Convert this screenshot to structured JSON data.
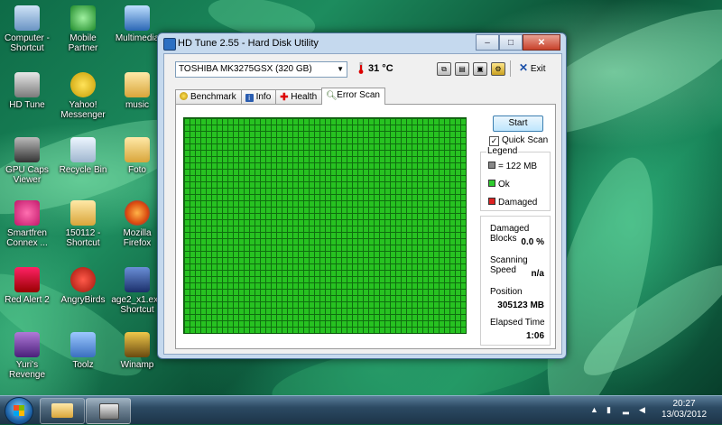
{
  "desktop": {
    "icons": [
      {
        "label": "Computer - Shortcut"
      },
      {
        "label": "Mobile Partner"
      },
      {
        "label": "Multimedia"
      },
      {
        "label": "HD Tune"
      },
      {
        "label": "Yahoo! Messenger"
      },
      {
        "label": "music"
      },
      {
        "label": "GPU Caps Viewer"
      },
      {
        "label": "Recycle Bin"
      },
      {
        "label": "Foto"
      },
      {
        "label": "Smartfren Connex ..."
      },
      {
        "label": "150112 - Shortcut"
      },
      {
        "label": "Mozilla Firefox"
      },
      {
        "label": "Red Alert 2"
      },
      {
        "label": "AngryBirds"
      },
      {
        "label": "age2_x1.exe Shortcut"
      },
      {
        "label": "Yuri's Revenge"
      },
      {
        "label": "Toolz"
      },
      {
        "label": "Winamp"
      }
    ]
  },
  "window": {
    "title": "HD Tune 2.55 - Hard Disk Utility",
    "controls": {
      "minimize": "–",
      "maximize": "□",
      "close": "✕"
    },
    "toolbar": {
      "drive": "TOSHIBA MK3275GSX (320 GB)",
      "temperature": "31 °C",
      "exit_label": "Exit"
    },
    "tabs": [
      {
        "label": "Benchmark"
      },
      {
        "label": "Info"
      },
      {
        "label": "Health"
      },
      {
        "label": "Error Scan"
      }
    ],
    "error_scan": {
      "start_label": "Start",
      "quick_scan_label": "Quick Scan",
      "quick_scan_checked": true,
      "legend_title": "Legend",
      "legend": [
        {
          "label": "= 122 MB",
          "color": "#888888"
        },
        {
          "label": "Ok",
          "color": "#2ecc2e"
        },
        {
          "label": "Damaged",
          "color": "#dd2222"
        }
      ],
      "stats": {
        "damaged_blocks_label": "Damaged Blocks",
        "damaged_blocks_value": "0.0 %",
        "scanning_speed_label": "Scanning Speed",
        "scanning_speed_value": "n/a",
        "position_label": "Position",
        "position_value": "305123 MB",
        "elapsed_label": "Elapsed Time",
        "elapsed_value": "1:06"
      }
    }
  },
  "taskbar": {
    "time": "20:27",
    "date": "13/03/2012"
  },
  "colors": {
    "ok_block": "#27c221",
    "grid_line": "#0f6e0f"
  }
}
